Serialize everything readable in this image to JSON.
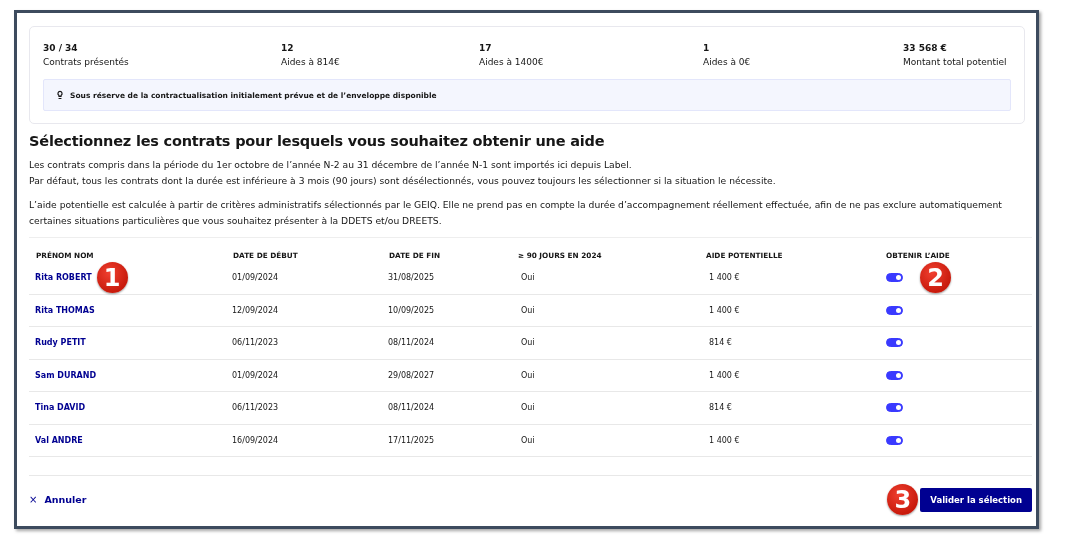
{
  "summary": {
    "stats": [
      {
        "value": "30 / 34",
        "label": "Contrats présentés"
      },
      {
        "value": "12",
        "label": "Aides à 814€"
      },
      {
        "value": "17",
        "label": "Aides à 1400€"
      },
      {
        "value": "1",
        "label": "Aides à 0€"
      },
      {
        "value": "33 568 €",
        "label": "Montant total potentiel"
      }
    ],
    "notice": "Sous réserve de la contractualisation initialement prévue et de l’enveloppe disponible"
  },
  "heading": "Sélectionnez les contrats pour lesquels vous souhaitez obtenir une aide",
  "paragraphs": [
    [
      "Les contrats compris dans la période du 1er octobre de l’année N-2 au 31 décembre de l’année N-1 sont importés ici depuis Label.",
      "Par défaut, tous les contrats dont la durée est inférieure à 3 mois (90 jours) sont désélectionnés, vous pouvez toujours les sélectionner si la situation le nécessite."
    ],
    [
      "L’aide potentielle est calculée à partir de critères administratifs sélectionnés par le GEIQ. Elle ne prend pas en compte la durée d’accompagnement réellement effectuée, afin de ne pas exclure automatiquement certaines situations particulières que vous souhaitez présenter à la DDETS et/ou DREETS."
    ]
  ],
  "table": {
    "columns": [
      "PRÉNOM NOM",
      "DATE DE DÉBUT",
      "DATE DE FIN",
      "≥ 90 JOURS EN 2024",
      "AIDE POTENTIELLE",
      "OBTENIR L’AIDE"
    ],
    "rows": [
      {
        "name": "Rita ROBERT",
        "start": "01/09/2024",
        "end": "31/08/2025",
        "over_90_days": "Oui",
        "aid": "1 400 €",
        "on": true,
        "name_callout": "1",
        "toggle_callout": "2"
      },
      {
        "name": "Rita THOMAS",
        "start": "12/09/2024",
        "end": "10/09/2025",
        "over_90_days": "Oui",
        "aid": "1 400 €",
        "on": true
      },
      {
        "name": "Rudy PETIT",
        "start": "06/11/2023",
        "end": "08/11/2024",
        "over_90_days": "Oui",
        "aid": "814 €",
        "on": true
      },
      {
        "name": "Sam DURAND",
        "start": "01/09/2024",
        "end": "29/08/2027",
        "over_90_days": "Oui",
        "aid": "1 400 €",
        "on": true
      },
      {
        "name": "Tina DAVID",
        "start": "06/11/2023",
        "end": "08/11/2024",
        "over_90_days": "Oui",
        "aid": "814 €",
        "on": true
      },
      {
        "name": "Val ANDRE",
        "start": "16/09/2024",
        "end": "17/11/2025",
        "over_90_days": "Oui",
        "aid": "1 400 €",
        "on": true
      }
    ]
  },
  "footer": {
    "cancel": {
      "icon": "×",
      "label": "Annuler"
    },
    "submit": {
      "label": "Valider la sélection",
      "callout": "3"
    }
  }
}
